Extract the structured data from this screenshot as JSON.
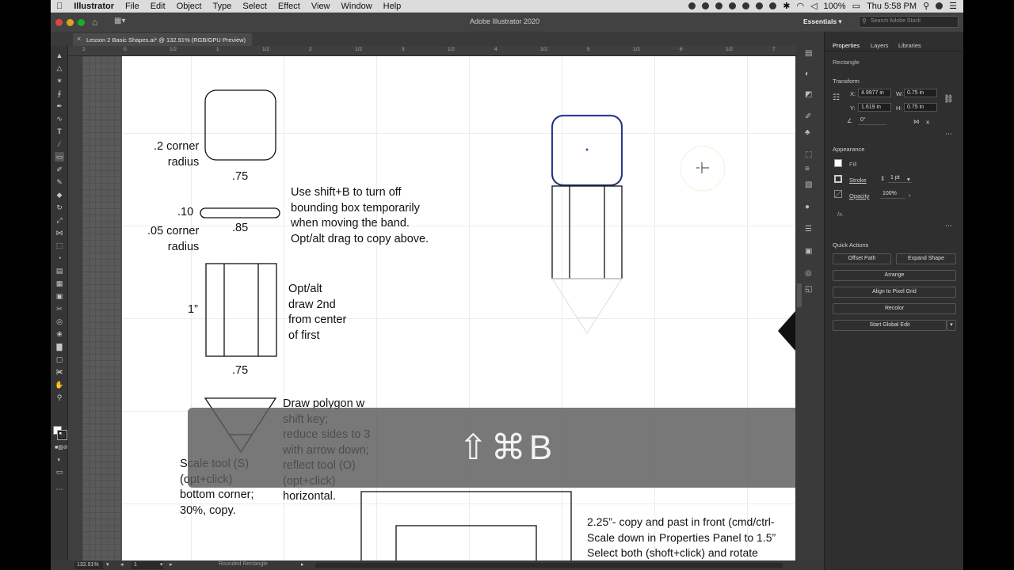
{
  "menubar": {
    "app": "Illustrator",
    "items": [
      "File",
      "Edit",
      "Object",
      "Type",
      "Select",
      "Effect",
      "View",
      "Window",
      "Help"
    ],
    "battery": "100%",
    "clock": "Thu 5:58 PM"
  },
  "titlebar": {
    "title": "Adobe Illustrator 2020",
    "workspace": "Essentials",
    "search_placeholder": "Search Adobe Stock"
  },
  "document_tab": {
    "label": "Lesson 2 Basic Shapes.ai* @ 132.91% (RGB/GPU Preview)"
  },
  "ruler": {
    "top_labels": [
      "2",
      "0",
      "1/2",
      "1",
      "1/2",
      "2",
      "1/2",
      "3",
      "1/2",
      "4",
      "1/2",
      "5",
      "1/2",
      "6",
      "1/2",
      "7"
    ]
  },
  "artboard": {
    "notes": {
      "corner_radius_2": ".2 corner\nradius",
      "width_75_a": ".75",
      "band_height": ".10",
      "band_width": ".85",
      "corner_radius_05": ".05 corner\nradius",
      "shift_b_note": "Use shift+B to turn off\nbounding box temporarily\nwhen moving the band.\nOpt/alt drag to copy above.",
      "height_1": "1”",
      "opt_alt_note": "Opt/alt\ndraw 2nd\nfrom center\nof first",
      "width_75_b": ".75",
      "polygon_note": "Draw polygon w\nshift key;\nreduce sides to 3\nwith arrow down;\nreflect tool (O)\n(opt+click)\nhorizontal.",
      "scale_note": "Scale tool (S)\n(opt+click)\nbottom corner;\n30%, copy.",
      "copy_note": "2.25”- copy and past in front (cmd/ctrl-\nScale down in Properties Panel to 1.5”\nSelect both (shoft+click) and rotate"
    }
  },
  "shortcut_overlay": {
    "keys": "⇧⌘B"
  },
  "properties_panel": {
    "tabs": [
      "Properties",
      "Layers",
      "Libraries"
    ],
    "object_type": "Rectangle",
    "transform": {
      "title": "Transform",
      "x_label": "X:",
      "x_value": "4.9977 in",
      "y_label": "Y:",
      "y_value": "1.619 in",
      "w_label": "W:",
      "w_value": "0.75 in",
      "h_label": "H:",
      "h_value": "0.75 in",
      "angle_value": "0°"
    },
    "appearance": {
      "title": "Appearance",
      "fill_label": "Fill",
      "stroke_label": "Stroke",
      "stroke_value": "1 pt",
      "opacity_label": "Opacity",
      "opacity_value": "100%",
      "fx_label": "fx."
    },
    "quick_actions": {
      "title": "Quick Actions",
      "offset_path": "Offset Path",
      "expand_shape": "Expand Shape",
      "arrange": "Arrange",
      "align_pixel": "Align to Pixel Grid",
      "recolor": "Recolor",
      "start_global_edit": "Start Global Edit"
    }
  },
  "statusbar": {
    "zoom": "132.91%",
    "artboard_number": "1",
    "selection": "Rounded Rectangle"
  },
  "colors": {
    "panel_bg": "#2f2f2f",
    "canvas_bg": "#5a5a5a",
    "selection_blue": "#3a4fb8"
  }
}
